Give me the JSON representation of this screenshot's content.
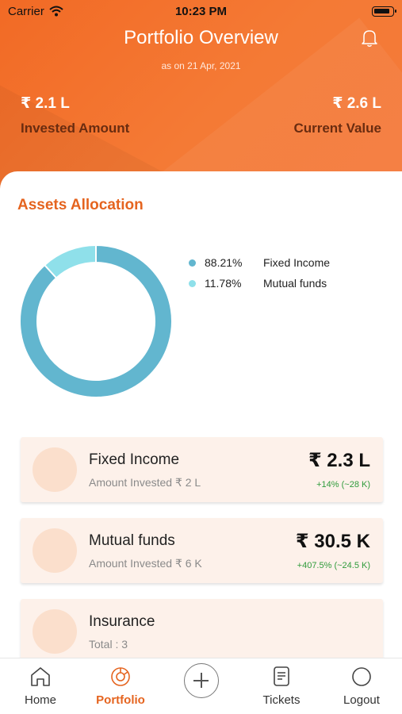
{
  "status_bar": {
    "carrier": "Carrier",
    "time": "10:23 PM"
  },
  "header": {
    "title": "Portfolio Overview",
    "subtitle": "as on 21 Apr, 2021",
    "invested": {
      "value": "₹ 2.1 L",
      "label": "Invested Amount"
    },
    "current": {
      "value": "₹ 2.6 L",
      "label": "Current Value"
    }
  },
  "allocation": {
    "title": "Assets Allocation",
    "items": [
      {
        "pct": "88.21%",
        "label": "Fixed Income",
        "color": "#62b6cf"
      },
      {
        "pct": "11.78%",
        "label": "Mutual funds",
        "color": "#8fe0ea"
      }
    ]
  },
  "chart_data": {
    "type": "pie",
    "donut": true,
    "categories": [
      "Fixed Income",
      "Mutual funds"
    ],
    "values": [
      88.21,
      11.78
    ],
    "colors": [
      "#62b6cf",
      "#8fe0ea"
    ],
    "title": "Assets Allocation"
  },
  "cards": [
    {
      "name": "Fixed Income",
      "sub": "Amount Invested ₹ 2 L",
      "amount": "₹ 2.3 L",
      "change": "+14% (~28 K)"
    },
    {
      "name": "Mutual funds",
      "sub": "Amount Invested ₹ 6 K",
      "amount": "₹ 30.5 K",
      "change": "+407.5% (~24.5 K)"
    },
    {
      "name": "Insurance",
      "sub": "Total : 3",
      "amount": "",
      "change": ""
    }
  ],
  "tabbar": {
    "items": [
      {
        "label": "Home",
        "icon": "home-icon"
      },
      {
        "label": "Portfolio",
        "icon": "portfolio-icon",
        "active": true
      },
      {
        "label": "",
        "icon": "plus-icon"
      },
      {
        "label": "Tickets",
        "icon": "tickets-icon"
      },
      {
        "label": "Logout",
        "icon": "logout-icon"
      }
    ]
  },
  "colors": {
    "accent": "#e5641f",
    "positive": "#2f9b3b",
    "header": "#f26a25"
  }
}
